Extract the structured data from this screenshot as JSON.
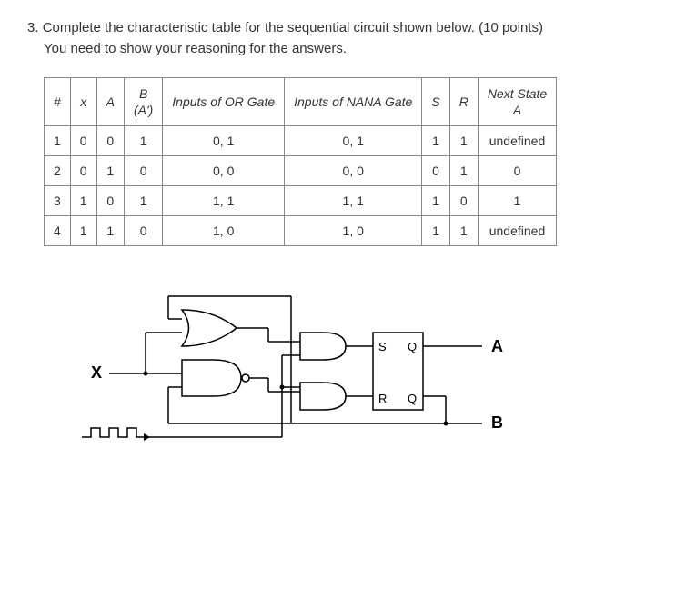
{
  "question": {
    "number": "3.",
    "prompt": "Complete the characteristic table for the sequential circuit shown below. (10 points)",
    "instruction": "You need to show your reasoning for the answers."
  },
  "table": {
    "headers": {
      "num": "#",
      "x": "x",
      "A": "A",
      "B": "B",
      "B_sub": "(A')",
      "or_gate": "Inputs of OR Gate",
      "nand_gate": "Inputs of NANA Gate",
      "S": "S",
      "R": "R",
      "next_state": "Next State",
      "next_state_sub": "A"
    },
    "rows": [
      {
        "num": "1",
        "x": "0",
        "A": "0",
        "B": "1",
        "or": "0, 1",
        "nand": "0, 1",
        "S": "1",
        "R": "1",
        "next": "undefined"
      },
      {
        "num": "2",
        "x": "0",
        "A": "1",
        "B": "0",
        "or": "0, 0",
        "nand": "0, 0",
        "S": "0",
        "R": "1",
        "next": "0"
      },
      {
        "num": "3",
        "x": "1",
        "A": "0",
        "B": "1",
        "or": "1, 1",
        "nand": "1, 1",
        "S": "1",
        "R": "0",
        "next": "1"
      },
      {
        "num": "4",
        "x": "1",
        "A": "1",
        "B": "0",
        "or": "1, 0",
        "nand": "1, 0",
        "S": "1",
        "R": "1",
        "next": "undefined"
      }
    ]
  },
  "circuit": {
    "input_x": "X",
    "latch_s": "S",
    "latch_q": "Q",
    "latch_r": "R",
    "latch_qbar": "Q̄",
    "output_a": "A",
    "output_b": "B"
  }
}
